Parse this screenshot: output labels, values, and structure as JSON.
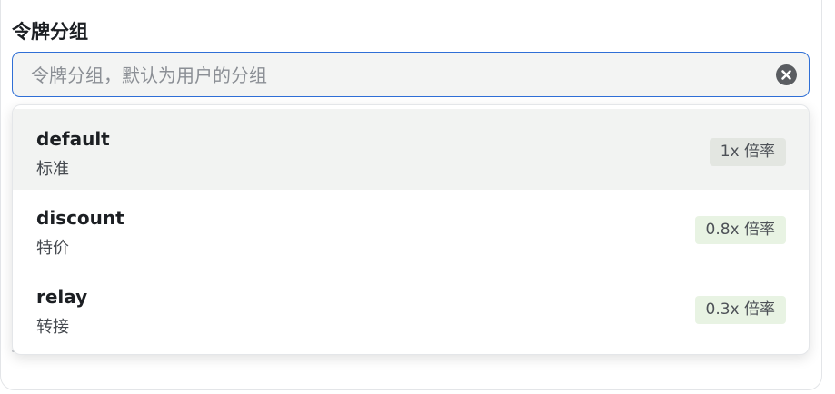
{
  "field": {
    "label": "令牌分组",
    "placeholder": "令牌分组，默认为用户的分组"
  },
  "options": [
    {
      "name": "default",
      "description": "标准",
      "rate": "1x 倍率",
      "selected": true
    },
    {
      "name": "discount",
      "description": "特价",
      "rate": "0.8x 倍率",
      "selected": false
    },
    {
      "name": "relay",
      "description": "转接",
      "rate": "0.3x 倍率",
      "selected": false
    }
  ],
  "colors": {
    "focus_border": "#2f6fd6",
    "selected_badge_bg": "#e3e6e1",
    "badge_bg": "#e8f3e3",
    "selected_row_bg": "#f2f3f2"
  },
  "icons": {
    "clear": "close-circle-icon"
  }
}
